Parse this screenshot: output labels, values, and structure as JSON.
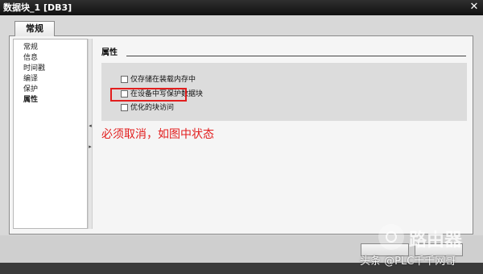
{
  "window": {
    "title": "数据块_1 [DB3]",
    "close_glyph": "✕"
  },
  "tabs": [
    {
      "label": "常规",
      "active": true
    }
  ],
  "nav": {
    "items": [
      {
        "label": "常规"
      },
      {
        "label": "信息"
      },
      {
        "label": "时间戳"
      },
      {
        "label": "编译"
      },
      {
        "label": "保护"
      },
      {
        "label": "属性",
        "active": true
      }
    ]
  },
  "splitter": {
    "collapse_glyph": "◂",
    "expand_glyph": "▸"
  },
  "properties": {
    "title": "属性",
    "options": [
      {
        "label": "仅存储在装载内存中",
        "checked": false
      },
      {
        "label": "在设备中写保护数据块",
        "checked": false
      },
      {
        "label": "优化的块访问",
        "checked": false,
        "highlighted": true
      }
    ]
  },
  "annotation": {
    "text": "必须取消，如图中状态",
    "color": "#e21e1e"
  },
  "watermark": {
    "brand": "路由器",
    "source": "头条 @PLC千千网哥"
  },
  "colors": {
    "highlight": "#e21e1e",
    "titlebar": "#1a1a1a"
  }
}
